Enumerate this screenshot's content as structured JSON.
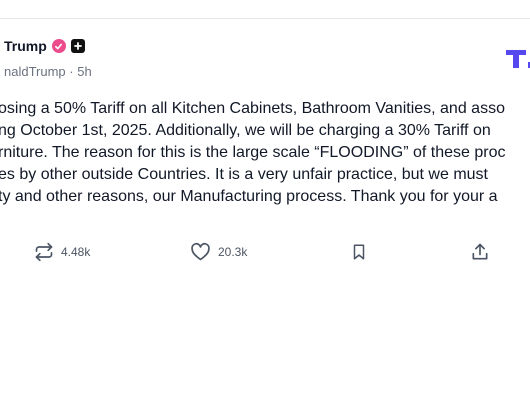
{
  "post": {
    "author_name": "Trump",
    "handle": "naldTrump",
    "separator": "·",
    "time": "5h",
    "lines": [
      "osing a 50% Tariff on all Kitchen Cabinets, Bathroom Vanities, and asso",
      "ng October 1st, 2025. Additionally, we will be charging a 30% Tariff on",
      "rniture. The reason for this is the large scale “FLOODING” of these proc",
      "es by other outside Countries. It is a very unfair practice, but we must",
      "ty and other reasons, our Manufacturing process. Thank you for your a"
    ]
  },
  "actions": {
    "retruth_count": "4.48k",
    "like_count": "20.3k"
  },
  "icons": {
    "verified": "verified-badge-icon",
    "plus": "plus-badge-icon",
    "retruth": "retruth-icon",
    "like": "heart-icon",
    "bookmark": "bookmark-icon",
    "share": "share-icon",
    "logo": "truth-social-logo"
  },
  "colors": {
    "verified": "#ec4b8c",
    "logo": "#5448ee",
    "text": "#111827",
    "muted": "#6b7280"
  }
}
